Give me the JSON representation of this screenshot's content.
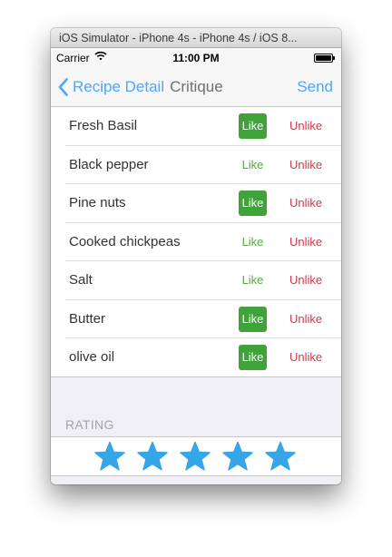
{
  "window": {
    "title": "iOS Simulator - iPhone 4s - iPhone 4s / iOS 8..."
  },
  "status_bar": {
    "carrier": "Carrier",
    "time": "11:00 PM",
    "wifi_icon": "wifi-icon",
    "battery_icon": "battery-icon"
  },
  "nav": {
    "back_label": "Recipe Detail",
    "title": "Critique",
    "send_label": "Send"
  },
  "ingredients": [
    {
      "name": "Fresh Basil",
      "like": "Like",
      "unlike": "Unlike",
      "liked": true
    },
    {
      "name": "Black pepper",
      "like": "Like",
      "unlike": "Unlike",
      "liked": false
    },
    {
      "name": "Pine nuts",
      "like": "Like",
      "unlike": "Unlike",
      "liked": true
    },
    {
      "name": "Cooked chickpeas",
      "like": "Like",
      "unlike": "Unlike",
      "liked": false
    },
    {
      "name": "Salt",
      "like": "Like",
      "unlike": "Unlike",
      "liked": false
    },
    {
      "name": "Butter",
      "like": "Like",
      "unlike": "Unlike",
      "liked": true
    },
    {
      "name": "olive oil",
      "like": "Like",
      "unlike": "Unlike",
      "liked": true
    }
  ],
  "rating": {
    "header": "RATING",
    "value": 5,
    "max": 5
  },
  "colors": {
    "accent": "#4da6ff",
    "like_green": "#3fa33a",
    "unlike_red": "#cc3b47",
    "star_blue": "#35a6e8"
  }
}
